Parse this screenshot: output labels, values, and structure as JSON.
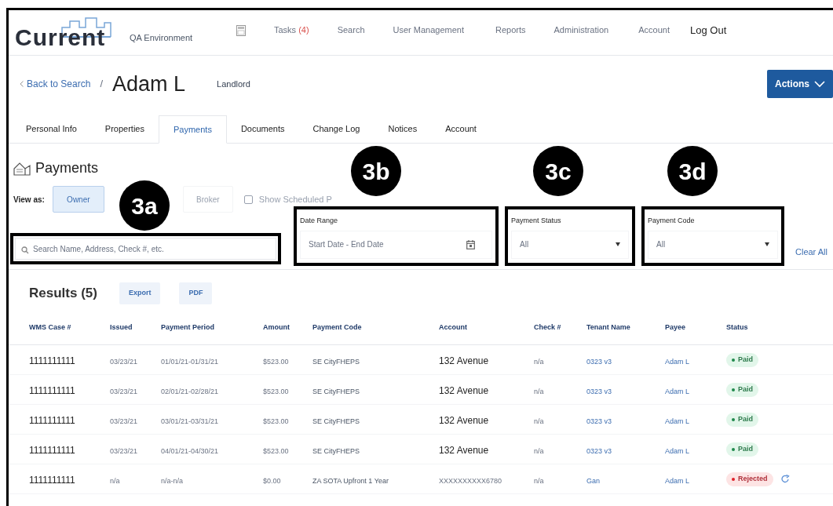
{
  "header": {
    "logo": "Current",
    "environment": "QA Environment",
    "nav": [
      {
        "label": "Tasks",
        "count": "(4)"
      },
      {
        "label": "Search"
      },
      {
        "label": "User Management"
      },
      {
        "label": "Reports"
      },
      {
        "label": "Administration"
      },
      {
        "label": "Account"
      },
      {
        "label": "Log Out",
        "emphasis": true
      }
    ]
  },
  "breadcrumb": {
    "back": "Back to Search",
    "separator": "/",
    "name": "Adam L",
    "role": "Landlord",
    "actions": "Actions"
  },
  "tabs": [
    {
      "label": "Personal Info",
      "selected": false
    },
    {
      "label": "Properties",
      "selected": false
    },
    {
      "label": "Payments",
      "selected": true
    },
    {
      "label": "Documents",
      "selected": false
    },
    {
      "label": "Change Log",
      "selected": false
    },
    {
      "label": "Notices",
      "selected": false
    },
    {
      "label": "Account",
      "selected": false
    }
  ],
  "section_title": "Payments",
  "view_as": {
    "label": "View as:",
    "options": [
      {
        "label": "Owner",
        "selected": true
      },
      {
        "label": "Broker",
        "selected": false
      }
    ],
    "show_scheduled": {
      "label": "Show Scheduled P",
      "checked": false
    }
  },
  "filters": {
    "search": {
      "placeholder": "Search Name, Address, Check #, etc."
    },
    "date_range": {
      "label": "Date Range",
      "placeholder": "Start Date - End Date"
    },
    "payment_status": {
      "label": "Payment Status",
      "value": "All"
    },
    "payment_code": {
      "label": "Payment Code",
      "value": "All"
    },
    "clear": "Clear All"
  },
  "results": {
    "title": "Results (5)",
    "buttons": [
      "Export",
      "PDF"
    ]
  },
  "table": {
    "columns": [
      "WMS Case #",
      "Issued",
      "Payment Period",
      "Amount",
      "Payment Code",
      "Account",
      "Check #",
      "Tenant Name",
      "Payee",
      "Status"
    ],
    "rows": [
      {
        "cells": [
          "1111111111",
          "03/23/21",
          "01/01/21-01/31/21",
          "$523.00",
          "SE CityFHEPS",
          "132 Avenue",
          "n/a",
          "0323 v3",
          "Adam L"
        ],
        "status": {
          "label": "Paid",
          "kind": "paid"
        },
        "retry": false
      },
      {
        "cells": [
          "1111111111",
          "03/23/21",
          "02/01/21-02/28/21",
          "$523.00",
          "SE CityFHEPS",
          "132 Avenue",
          "n/a",
          "0323 v3",
          "Adam L"
        ],
        "status": {
          "label": "Paid",
          "kind": "paid"
        },
        "retry": false
      },
      {
        "cells": [
          "1111111111",
          "03/23/21",
          "03/01/21-03/31/21",
          "$523.00",
          "SE CityFHEPS",
          "132 Avenue",
          "n/a",
          "0323 v3",
          "Adam L"
        ],
        "status": {
          "label": "Paid",
          "kind": "paid"
        },
        "retry": false
      },
      {
        "cells": [
          "1111111111",
          "03/23/21",
          "04/01/21-04/30/21",
          "$523.00",
          "SE CityFHEPS",
          "132 Avenue",
          "n/a",
          "0323 v3",
          "Adam L"
        ],
        "status": {
          "label": "Paid",
          "kind": "paid"
        },
        "retry": false
      },
      {
        "cells": [
          "1111111111",
          "n/a",
          "n/a-n/a",
          "$0.00",
          "ZA SOTA Upfront 1 Year",
          "XXXXXXXXXX6780",
          "n/a",
          "Gan",
          "Adam L"
        ],
        "status": {
          "label": "Rejected",
          "kind": "rejected"
        },
        "retry": true
      }
    ]
  },
  "annotations": [
    "3a",
    "3b",
    "3c",
    "3d"
  ]
}
